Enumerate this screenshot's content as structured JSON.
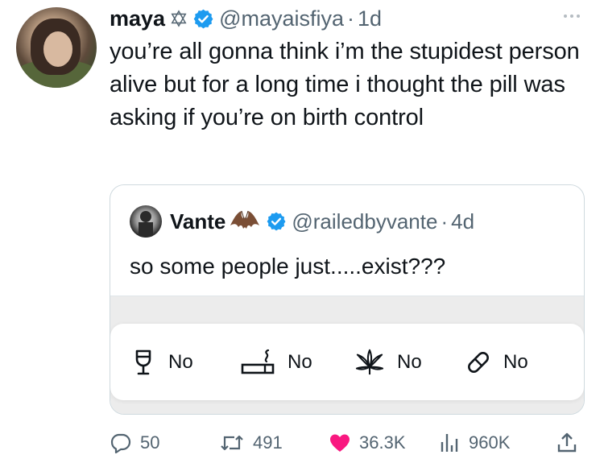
{
  "tweet": {
    "author_name": "maya",
    "handle": "@mayaisfiya",
    "dot": "·",
    "time": "1d",
    "text": "you’re all gonna think i’m the stupidest person alive but for a long time i thought the pill was asking if you’re on birth control",
    "icons": {
      "badge_emoji": "star-of-david-icon",
      "verified": "verified-badge-icon",
      "more": "more-icon"
    }
  },
  "quote": {
    "author_name": "Vante",
    "handle": "@railedbyvante",
    "dot": "·",
    "time": "4d",
    "text": "so some people just.....exist???",
    "choices": [
      {
        "icon": "wine-glass-icon",
        "label": "No"
      },
      {
        "icon": "cigarette-icon",
        "label": "No"
      },
      {
        "icon": "cannabis-leaf-icon",
        "label": "No"
      },
      {
        "icon": "pill-icon",
        "label": "No"
      }
    ]
  },
  "actions": {
    "replies": "50",
    "retweets": "491",
    "likes": "36.3K",
    "views": "960K"
  },
  "colors": {
    "verified_blue": "#1d9bf0",
    "like_pink": "#f91880",
    "secondary_text": "#536471",
    "text": "#0f1419"
  }
}
